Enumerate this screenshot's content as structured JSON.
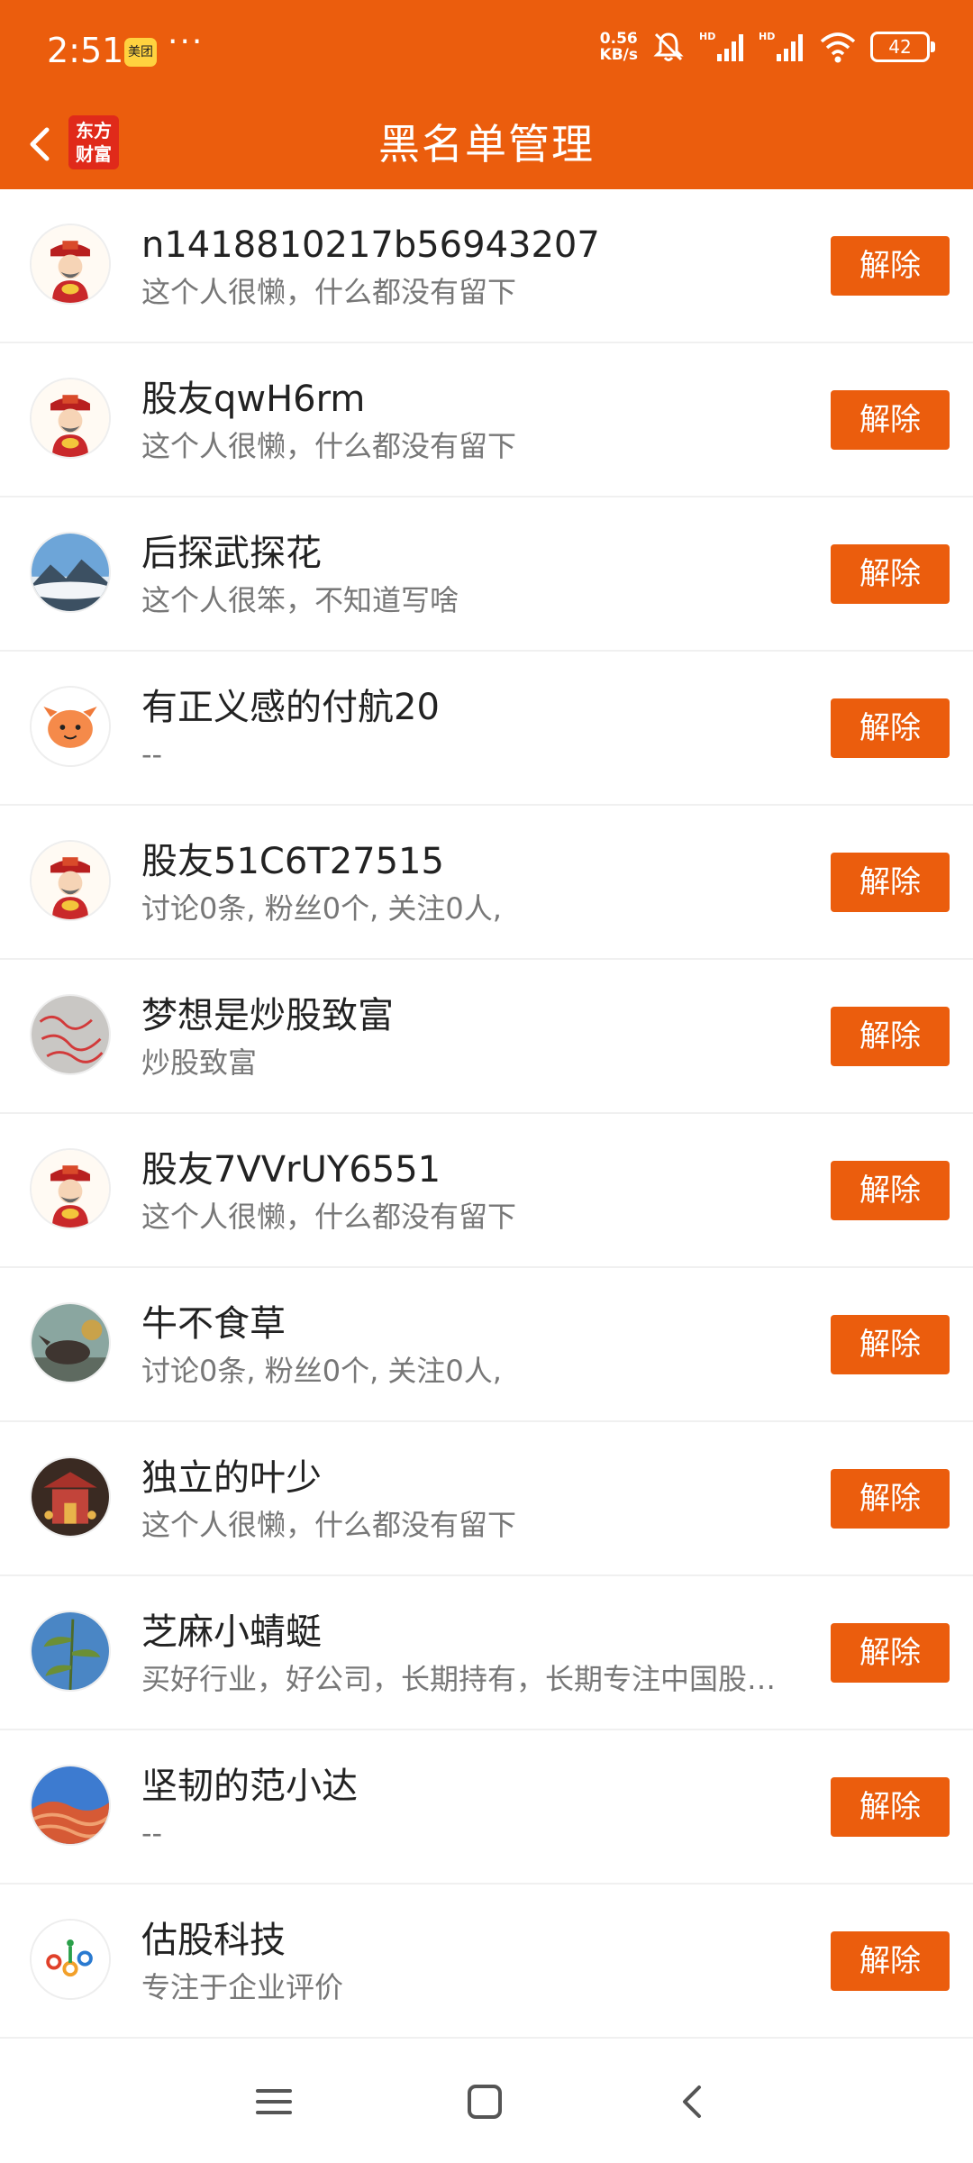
{
  "status_bar": {
    "time": "2:51",
    "app_badge": "美团",
    "more": "···",
    "net_speed_value": "0.56",
    "net_speed_unit": "KB/s",
    "battery": "42"
  },
  "header": {
    "logo_line1": "东方",
    "logo_line2": "财富",
    "title": "黑名单管理"
  },
  "remove_label": "解除",
  "users": [
    {
      "name": "n1418810217b56943207",
      "bio": "这个人很懒，什么都没有留下",
      "avatar": "god-of-wealth"
    },
    {
      "name": "股友qwH6rm",
      "bio": "这个人很懒，什么都没有留下",
      "avatar": "god-of-wealth"
    },
    {
      "name": "后探武探花",
      "bio": "这个人很笨，不知道写啥",
      "avatar": "mountain-clouds"
    },
    {
      "name": "有正义感的付航20",
      "bio": "--",
      "avatar": "orange-bull"
    },
    {
      "name": "股友51C6T27515",
      "bio": "讨论0条, 粉丝0个, 关注0人,",
      "avatar": "god-of-wealth"
    },
    {
      "name": "梦想是炒股致富",
      "bio": "炒股致富",
      "avatar": "handwriting"
    },
    {
      "name": "股友7VVrUY6551",
      "bio": "这个人很懒，什么都没有留下",
      "avatar": "god-of-wealth"
    },
    {
      "name": "牛不食草",
      "bio": "讨论0条, 粉丝0个, 关注0人,",
      "avatar": "wall-street-bull"
    },
    {
      "name": "独立的叶少",
      "bio": "这个人很懒，什么都没有留下",
      "avatar": "temple"
    },
    {
      "name": "芝麻小蜻蜓",
      "bio": "买好行业，好公司，长期持有，长期专注中国股…",
      "avatar": "plant"
    },
    {
      "name": "坚韧的范小达",
      "bio": "--",
      "avatar": "red-rock"
    },
    {
      "name": "估股科技",
      "bio": "专注于企业评价",
      "avatar": "gugu-logo"
    }
  ],
  "colors": {
    "accent": "#eb5d0d",
    "text_primary": "#222222",
    "text_secondary": "#777777"
  },
  "nav_icons": [
    "menu-icon",
    "home-icon",
    "back-icon"
  ]
}
